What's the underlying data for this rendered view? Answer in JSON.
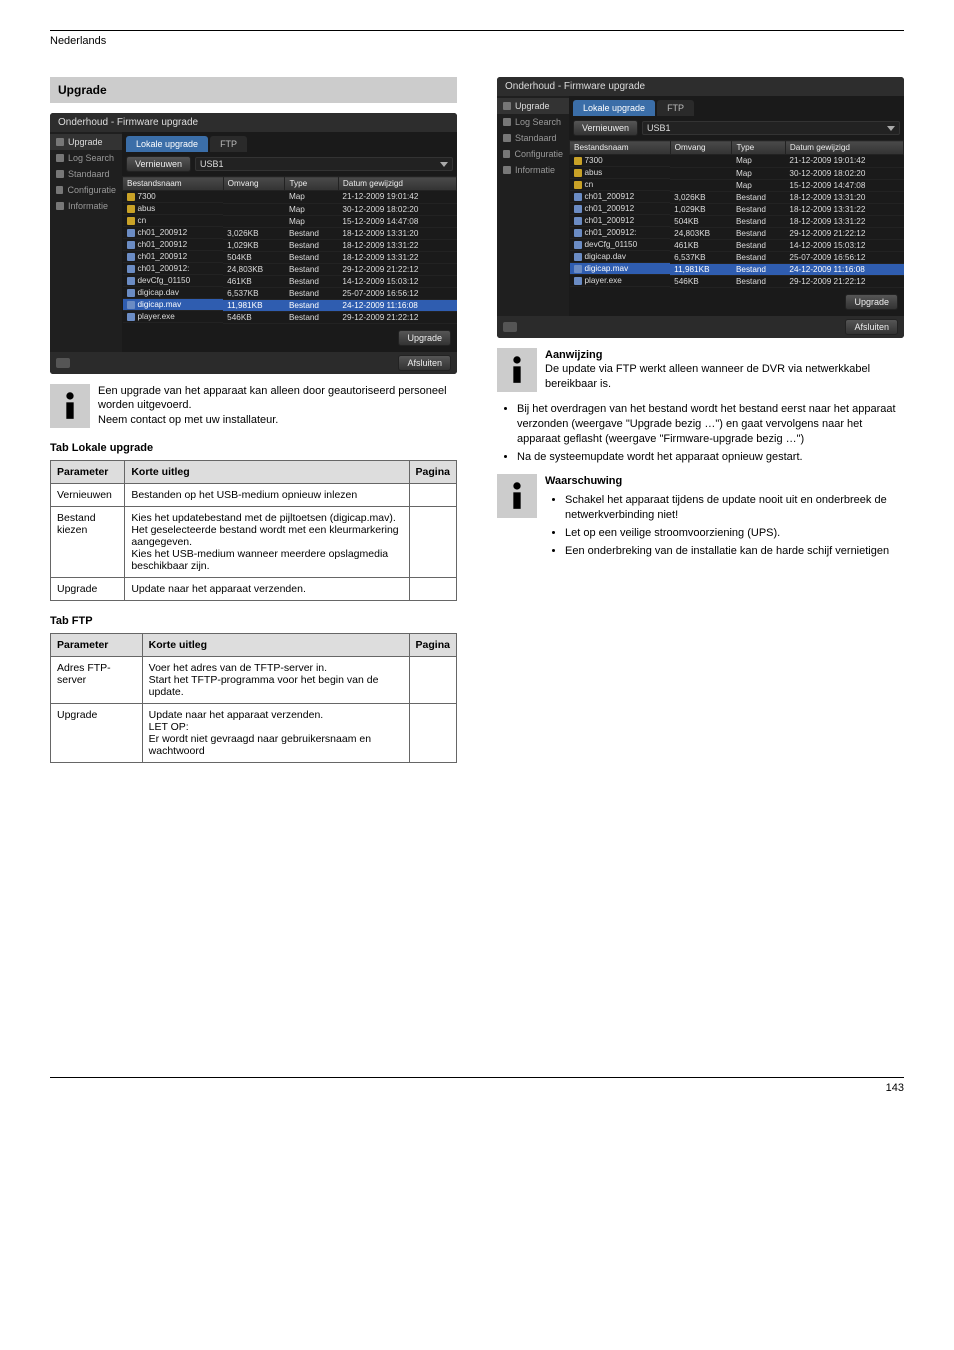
{
  "header": {
    "left": "Nederlands",
    "right": ""
  },
  "section_title": "Upgrade",
  "screenshot": {
    "title": "Onderhoud - Firmware upgrade",
    "sidebar": [
      "Upgrade",
      "Log Search",
      "Standaard",
      "Configuratie",
      "Informatie"
    ],
    "tabs": {
      "active": "Lokale upgrade",
      "inactive": "FTP"
    },
    "refresh_btn": "Vernieuwen",
    "combo_value": "USB1",
    "cols": [
      "Bestandsnaam",
      "Omvang",
      "Type",
      "Datum gewijzigd"
    ],
    "rows": [
      {
        "icon": "folder",
        "name": "7300",
        "size": "",
        "type": "Map",
        "date": "21-12-2009 19:01:42",
        "hl": false
      },
      {
        "icon": "folder",
        "name": "abus",
        "size": "",
        "type": "Map",
        "date": "30-12-2009 18:02:20",
        "hl": false
      },
      {
        "icon": "folder",
        "name": "cn",
        "size": "",
        "type": "Map",
        "date": "15-12-2009 14:47:08",
        "hl": false
      },
      {
        "icon": "file",
        "name": "ch01_200912",
        "size": "3,026KB",
        "type": "Bestand",
        "date": "18-12-2009 13:31:20",
        "hl": false
      },
      {
        "icon": "file",
        "name": "ch01_200912",
        "size": "1,029KB",
        "type": "Bestand",
        "date": "18-12-2009 13:31:22",
        "hl": false
      },
      {
        "icon": "file",
        "name": "ch01_200912",
        "size": "504KB",
        "type": "Bestand",
        "date": "18-12-2009 13:31:22",
        "hl": false
      },
      {
        "icon": "file",
        "name": "ch01_200912:",
        "size": "24,803KB",
        "type": "Bestand",
        "date": "29-12-2009 21:22:12",
        "hl": false
      },
      {
        "icon": "file",
        "name": "devCfg_01150",
        "size": "461KB",
        "type": "Bestand",
        "date": "14-12-2009 15:03:12",
        "hl": false
      },
      {
        "icon": "file",
        "name": "digicap.dav",
        "size": "6,537KB",
        "type": "Bestand",
        "date": "25-07-2009 16:56:12",
        "hl": false
      },
      {
        "icon": "file",
        "name": "digicap.mav",
        "size": "11,981KB",
        "type": "Bestand",
        "date": "24-12-2009 11:16:08",
        "hl": true
      },
      {
        "icon": "file",
        "name": "player.exe",
        "size": "546KB",
        "type": "Bestand",
        "date": "29-12-2009 21:22:12",
        "hl": false
      }
    ],
    "upgrade_btn": "Upgrade",
    "close_btn": "Afsluiten"
  },
  "left": {
    "note1": "Een upgrade van het apparaat kan alleen door geautoriseerd personeel worden uitgevoerd.\nNeem contact op met uw installateur.",
    "tab_local_hdr": "Tab Lokale upgrade",
    "table1": {
      "head": [
        "Parameter",
        "Korte uitleg",
        "Pagina"
      ],
      "rows": [
        [
          "Vernieuwen",
          "Bestanden op het USB-medium opnieuw inlezen",
          ""
        ],
        [
          "Bestand kiezen",
          "Kies het updatebestand met de pijltoetsen (digicap.mav). Het geselecteerde bestand wordt met een kleurmarkering aangegeven.\nKies het USB-medium wanneer meerdere opslagmedia beschikbaar zijn.",
          ""
        ],
        [
          "Upgrade",
          "Update naar het apparaat verzenden.",
          ""
        ]
      ]
    },
    "tab_ftp_hdr": "Tab FTP",
    "table2": {
      "head": [
        "Parameter",
        "Korte uitleg",
        "Pagina"
      ],
      "rows": [
        [
          "Adres FTP-server",
          "Voer het adres van de TFTP-server in.\nStart het TFTP-programma voor het begin van de update.",
          ""
        ],
        [
          "Upgrade",
          "Update naar het apparaat verzenden.\nLET OP:\nEr wordt niet gevraagd naar gebruikersnaam en wachtwoord",
          ""
        ]
      ]
    }
  },
  "right": {
    "note_hdr": "Aanwijzing",
    "note_body": "De update via FTP werkt alleen wanneer de DVR via netwerkkabel bereikbaar is.",
    "bullets1": [
      "Bij het overdragen van het bestand wordt het bestand eerst naar het apparaat verzonden (weergave \"Upgrade bezig …\") en gaat vervolgens naar het apparaat geflasht (weergave \"Firmware-upgrade bezig …\")",
      "Na de systeemupdate wordt het apparaat opnieuw gestart."
    ],
    "warn_hdr": "Waarschuwing",
    "bullets2": [
      "Schakel het apparaat tijdens de update nooit uit en onderbreek de netwerkverbinding niet!",
      "Let op een veilige stroomvoorziening (UPS).",
      "Een onderbreking van de installatie kan de harde schijf vernietigen"
    ]
  },
  "footer_page": "143"
}
